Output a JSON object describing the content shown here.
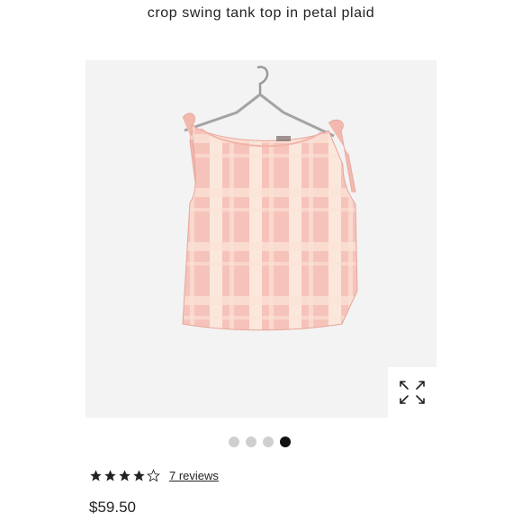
{
  "product": {
    "title": "crop swing tank top in petal plaid",
    "price": "$59.50",
    "image_icon": "tank-top-product-photo"
  },
  "gallery": {
    "image_count": 4,
    "active_index": 3,
    "expand_icon": "expand-arrows-icon"
  },
  "rating": {
    "stars": 4,
    "max_stars": 5,
    "reviews_label": "7 reviews"
  },
  "colors": {
    "accent": "#111111",
    "background": "#f3f3f3",
    "fabric_pink": "#f6c3bb",
    "fabric_light": "#fbe7dc"
  }
}
